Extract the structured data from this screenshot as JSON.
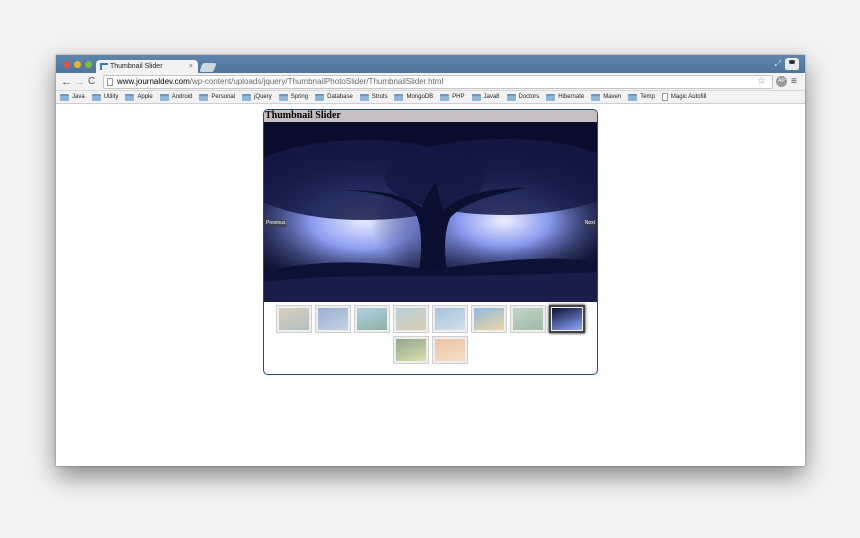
{
  "browser": {
    "tab_title": "Thumbnail Slider",
    "tab_close": "×",
    "url_host": "www.journaldev.com",
    "url_path": "/wp-content/uploads/jquery/ThumbnailPhotoSlider/ThumbnailSlider.html",
    "back_glyph": "←",
    "forward_glyph": "→",
    "reload_glyph": "C",
    "star_glyph": "☆",
    "ext_label": "AP",
    "menu_glyph": "≡"
  },
  "bookmarks": [
    {
      "label": "Java",
      "icon": "folder-icon"
    },
    {
      "label": "Utility",
      "icon": "folder-icon"
    },
    {
      "label": "Apple",
      "icon": "folder-icon"
    },
    {
      "label": "Android",
      "icon": "folder-icon"
    },
    {
      "label": "Personal",
      "icon": "folder-icon"
    },
    {
      "label": "jQuery",
      "icon": "folder-icon"
    },
    {
      "label": "Spring",
      "icon": "folder-icon"
    },
    {
      "label": "Database",
      "icon": "folder-icon"
    },
    {
      "label": "Struts",
      "icon": "folder-icon"
    },
    {
      "label": "MongoDB",
      "icon": "folder-icon"
    },
    {
      "label": "PHP",
      "icon": "folder-icon"
    },
    {
      "label": "Java8",
      "icon": "folder-icon"
    },
    {
      "label": "Doctors",
      "icon": "folder-icon"
    },
    {
      "label": "Hibernate",
      "icon": "folder-icon"
    },
    {
      "label": "Maven",
      "icon": "folder-icon"
    },
    {
      "label": "Temp",
      "icon": "folder-icon"
    },
    {
      "label": "Magic Autofill",
      "icon": "doc-icon"
    }
  ],
  "slider": {
    "title": "Thumbnail Slider",
    "prev_label": "Previous",
    "next_label": "Next",
    "active_index": 7,
    "thumbnails": [
      {
        "colors": [
          "#c9b690",
          "#7f9aa0"
        ]
      },
      {
        "colors": [
          "#5a7fb8",
          "#9fb9d9"
        ]
      },
      {
        "colors": [
          "#7fb7d3",
          "#3f7f6f"
        ]
      },
      {
        "colors": [
          "#8fb7c9",
          "#c9b37f"
        ]
      },
      {
        "colors": [
          "#6f9fc9",
          "#b9d3e9"
        ]
      },
      {
        "colors": [
          "#3f8fd9",
          "#f0c060"
        ]
      },
      {
        "colors": [
          "#9fc3a0",
          "#5f8f6f"
        ]
      },
      {
        "colors": [
          "#0b1030",
          "#8fa8ff"
        ]
      },
      {
        "colors": [
          "#3f6f3f",
          "#c9d36f"
        ]
      },
      {
        "colors": [
          "#e9a070",
          "#f9d3a0"
        ]
      }
    ]
  }
}
